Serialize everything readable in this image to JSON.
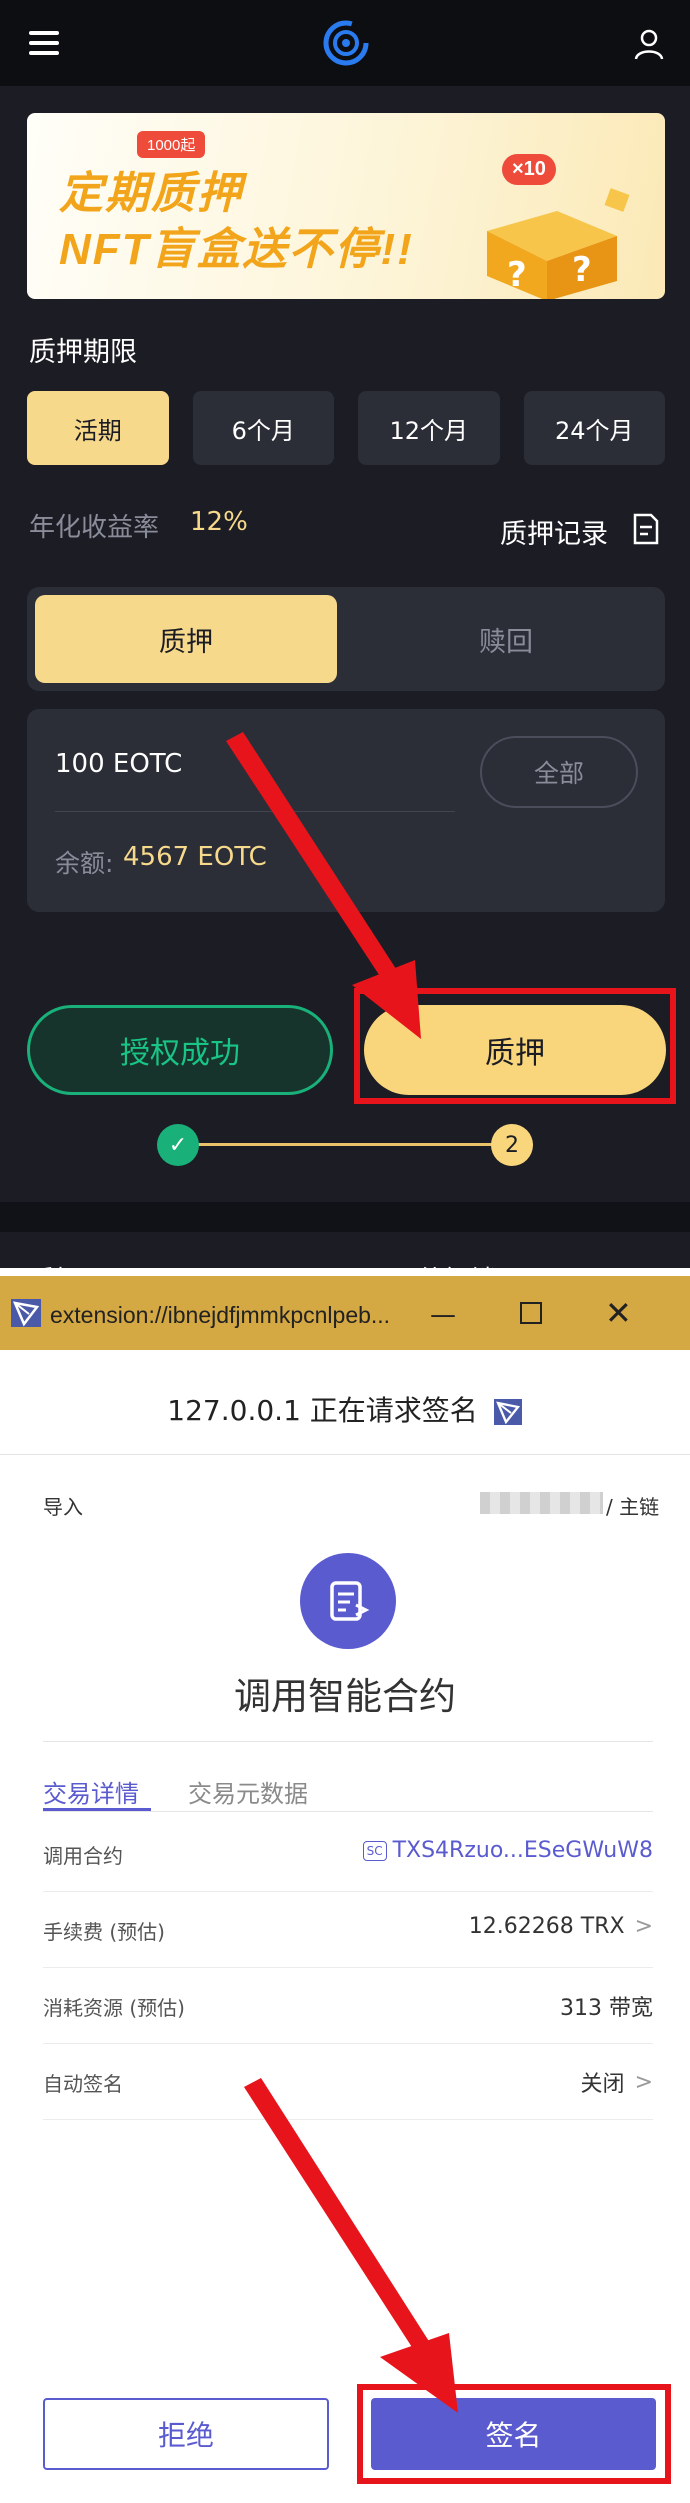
{
  "app": {
    "banner": {
      "tag": "1000起",
      "line1": "定期质押",
      "line2": "NFT盲盒送不停!!",
      "multiplier": "×10"
    },
    "period_section_title": "质押期限",
    "periods": [
      "活期",
      "6个月",
      "12个月",
      "24个月"
    ],
    "active_period": "活期",
    "annual_rate_label": "年化收益率",
    "annual_rate_value": "12%",
    "records_label": "质押记录",
    "tabs": {
      "stake": "质押",
      "redeem": "赎回"
    },
    "amount_value": "100 EOTC",
    "all_button": "全部",
    "balance_label": "余额:",
    "balance_value": "4567 EOTC",
    "authorized_button": "授权成功",
    "stake_button": "质押",
    "steps": {
      "step2_label": "2"
    },
    "lower_labels": [
      "质押",
      "待解锁"
    ]
  },
  "popup": {
    "window_title": "extension://ibnejdfjmmkpcnlpeb...",
    "request_title": "127.0.0.1 正在请求签名",
    "import_label": "导入",
    "chain_label": "/ 主链",
    "contract_title": "调用智能合约",
    "tabs": [
      "交易详情",
      "交易元数据"
    ],
    "rows": [
      {
        "label": "调用合约",
        "value": "TXS4Rzuo...ESeGWuW8",
        "badge": "SC"
      },
      {
        "label": "手续费 (预估)",
        "value": "12.62268 TRX"
      },
      {
        "label": "消耗资源 (预估)",
        "value": "313 带宽"
      },
      {
        "label": "自动签名",
        "value": "关闭"
      }
    ],
    "reject_button": "拒绝",
    "sign_button": "签名"
  },
  "colors": {
    "gold": "#f7d98c",
    "green": "#19b07a",
    "purple": "#5b5bd0",
    "highlight_red": "#e8141b"
  }
}
